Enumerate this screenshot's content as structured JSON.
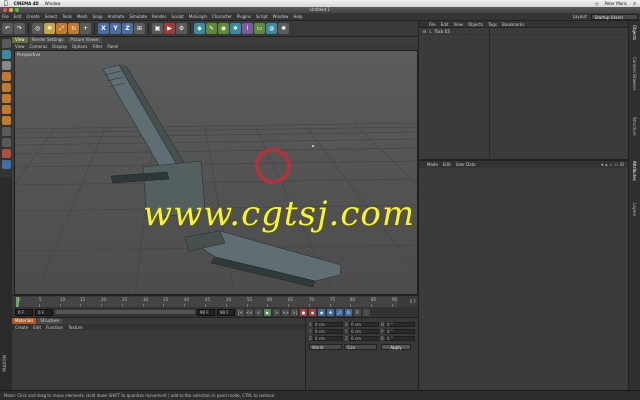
{
  "mac_menu": {
    "app_name": "CINEMA 4D",
    "items": [
      "Window"
    ],
    "user": "Peter Maric"
  },
  "window": {
    "title": "Untitled 1"
  },
  "c4d_menu": {
    "items": [
      "File",
      "Edit",
      "Create",
      "Select",
      "Tools",
      "Mesh",
      "Snap",
      "Animate",
      "Simulate",
      "Render",
      "Sculpt",
      "MoGraph",
      "Character",
      "Plugins",
      "Script",
      "Window",
      "Help"
    ],
    "layout_label": "Layout:",
    "layout_value": "Startup (User)"
  },
  "toolbar": {
    "axis_labels": [
      "X",
      "Y",
      "Z"
    ]
  },
  "viewport": {
    "tabs": [
      "View",
      "Render Settings",
      "Picture Viewer"
    ],
    "menu": [
      "View",
      "Cameras",
      "Display",
      "Options",
      "Filter",
      "Panel"
    ],
    "label": "Perspective",
    "watermark": "www.cgtsj.com"
  },
  "timeline": {
    "ticks": [
      "0",
      "5",
      "10",
      "15",
      "20",
      "25",
      "30",
      "35",
      "40",
      "45",
      "50",
      "55",
      "60",
      "65",
      "70",
      "75",
      "80",
      "85",
      "90"
    ],
    "end_label": "0 F"
  },
  "playback": {
    "start_field": "0 F",
    "end_field": "90 F",
    "current_frame": "0 F",
    "buttons": [
      "|<",
      "<<",
      "<",
      "▶",
      ">",
      ">>",
      ">|"
    ]
  },
  "materials": {
    "tabs": [
      "Materials",
      "Structure"
    ],
    "menu": [
      "Create",
      "Edit",
      "Function",
      "Texture"
    ]
  },
  "coordinates": {
    "rows": [
      [
        {
          "axis": "X",
          "value": "0 cm"
        },
        {
          "axis": "X",
          "value": "0 cm"
        },
        {
          "axis": "H",
          "value": "0 °"
        }
      ],
      [
        {
          "axis": "Y",
          "value": "0 cm"
        },
        {
          "axis": "Y",
          "value": "0 cm"
        },
        {
          "axis": "P",
          "value": "0 °"
        }
      ],
      [
        {
          "axis": "Z",
          "value": "0 cm"
        },
        {
          "axis": "Z",
          "value": "0 cm"
        },
        {
          "axis": "B",
          "value": "0 °"
        }
      ]
    ],
    "mode_dropdown": "World",
    "size_dropdown": "Size",
    "apply_label": "Apply"
  },
  "object_manager": {
    "menu": [
      "File",
      "Edit",
      "View",
      "Objects",
      "Tags",
      "Bookmarks"
    ],
    "objects": [
      {
        "name": "Tock 03"
      }
    ]
  },
  "attribute_manager": {
    "menu": [
      "Mode",
      "Edit",
      "User Data"
    ]
  },
  "side_tabs": [
    "Objects",
    "Content Browser",
    "Structure",
    "Attributes",
    "Layers"
  ],
  "maxon_label": "MAXON",
  "status": {
    "text": "Move: Click and drag to move elements. Hold down SHIFT to quantize movement / add to the selection in point mode, CTRL to remove."
  },
  "colors": {
    "watermark": "#f7f23a",
    "selection_ring": "#c0303a",
    "model_fill": "#5f6e72",
    "active_tab": "#b05a2a"
  }
}
